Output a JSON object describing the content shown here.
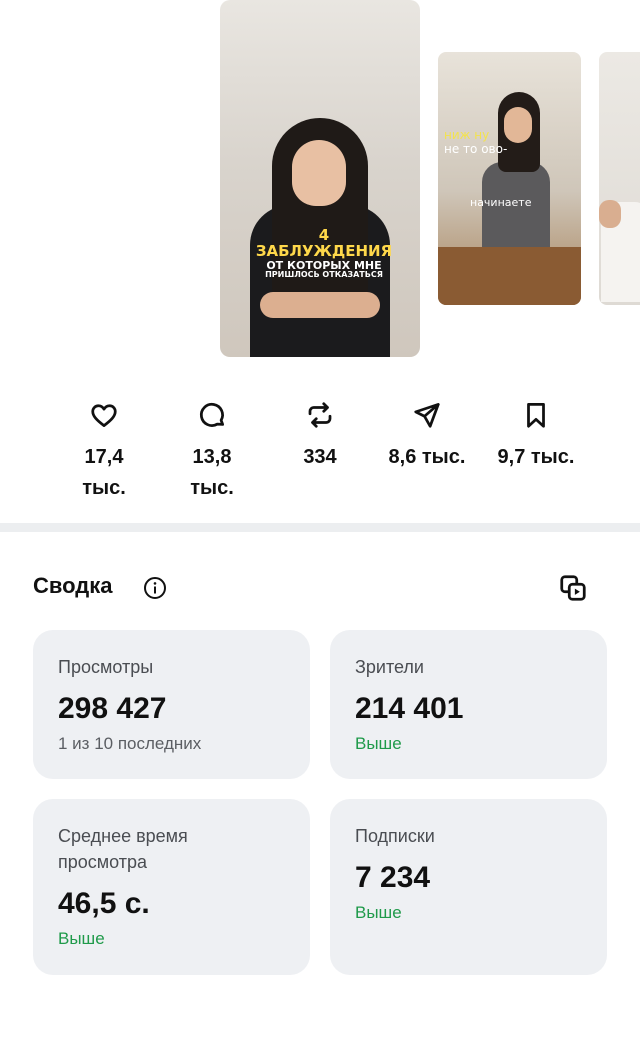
{
  "thumbnails": {
    "main_overlay": {
      "line1": "4 заблуждения",
      "line2": "от которых мне",
      "line3": "пришлось отказаться"
    },
    "second_overlay": {
      "yellow_text": "ниж    ну",
      "white_text": "не то    ово-",
      "caption": "начинаете"
    }
  },
  "actions": [
    {
      "icon": "heart-icon",
      "count": "17,4 тыс."
    },
    {
      "icon": "comment-icon",
      "count": "13,8 тыс."
    },
    {
      "icon": "repost-icon",
      "count": "334"
    },
    {
      "icon": "share-icon",
      "count": "8,6 тыс."
    },
    {
      "icon": "bookmark-icon",
      "count": "9,7 тыс."
    }
  ],
  "summary": {
    "title": "Сводка",
    "cards": [
      {
        "label": "Просмотры",
        "value": "298 427",
        "note": "1 из 10 последних"
      },
      {
        "label": "Зрители",
        "value": "214 401",
        "note": "Выше"
      },
      {
        "label": "Среднее время просмотра",
        "value": "46,5 с.",
        "note": "Выше"
      },
      {
        "label": "Подписки",
        "value": "7 234",
        "note": "Выше"
      }
    ]
  },
  "colors": {
    "positive": "#1f9a4a",
    "card_bg": "#eef0f3",
    "divider": "#eceef0"
  }
}
